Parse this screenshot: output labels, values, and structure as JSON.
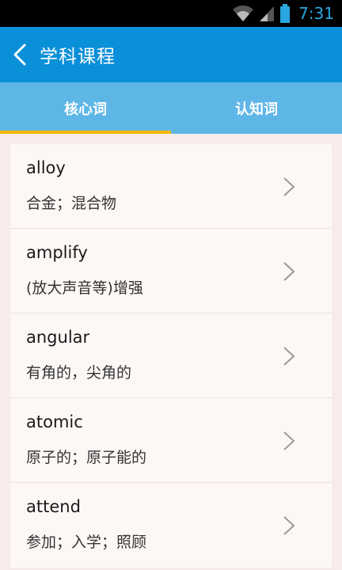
{
  "status": {
    "time": "7:31"
  },
  "header": {
    "title": "学科课程"
  },
  "tabs": [
    {
      "label": "核心词",
      "active": true
    },
    {
      "label": "认知词",
      "active": false
    }
  ],
  "words": [
    {
      "word": "alloy",
      "meaning": "合金；混合物"
    },
    {
      "word": "amplify",
      "meaning": "(放大声音等)增强"
    },
    {
      "word": "angular",
      "meaning": "有角的，尖角的"
    },
    {
      "word": "atomic",
      "meaning": "原子的；原子能的"
    },
    {
      "word": "attend",
      "meaning": "参加；入学；照顾"
    }
  ],
  "colors": {
    "appbar": "#0a8fd9",
    "tabbar": "#5db6e6",
    "tab_indicator": "#f5b800"
  }
}
